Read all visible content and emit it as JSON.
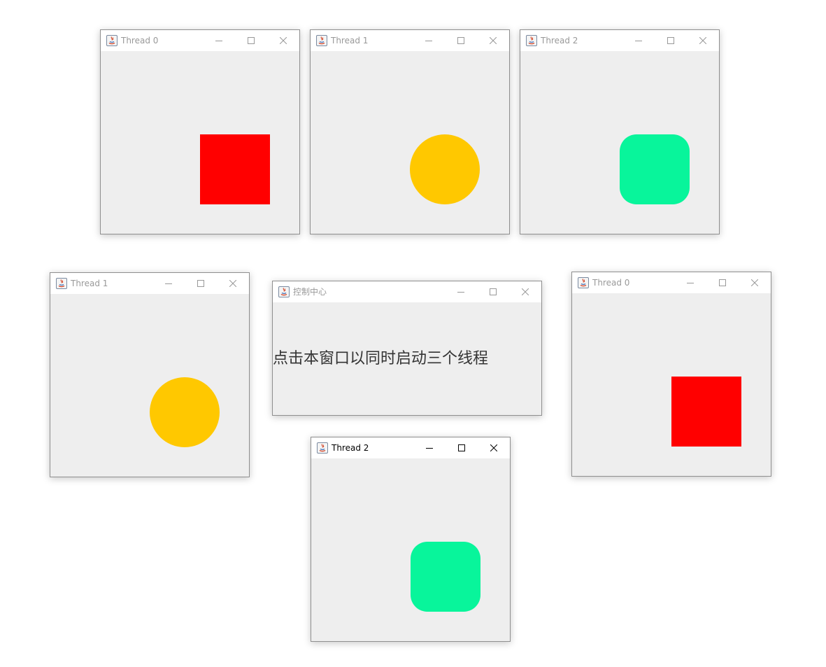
{
  "windows": [
    {
      "id": "w1",
      "title": "Thread 0",
      "shape": "square",
      "color": "#ff0000",
      "active": false
    },
    {
      "id": "w2",
      "title": "Thread 1",
      "shape": "circle",
      "color": "#ffc800",
      "active": false
    },
    {
      "id": "w3",
      "title": "Thread 2",
      "shape": "rounded-square",
      "color": "#08f59b",
      "active": false
    },
    {
      "id": "w4",
      "title": "Thread 1",
      "shape": "circle",
      "color": "#ffc800",
      "active": false
    },
    {
      "id": "w5",
      "title": "控制中心",
      "message": "点击本窗口以同时启动三个线程",
      "active": false
    },
    {
      "id": "w6",
      "title": "Thread 0",
      "shape": "square",
      "color": "#ff0000",
      "active": false
    },
    {
      "id": "w7",
      "title": "Thread 2",
      "shape": "rounded-square",
      "color": "#08f59b",
      "active": true
    }
  ],
  "icons": {
    "app": "java-app-icon",
    "minimize": "minimize-icon",
    "maximize": "maximize-icon",
    "close": "close-icon"
  }
}
